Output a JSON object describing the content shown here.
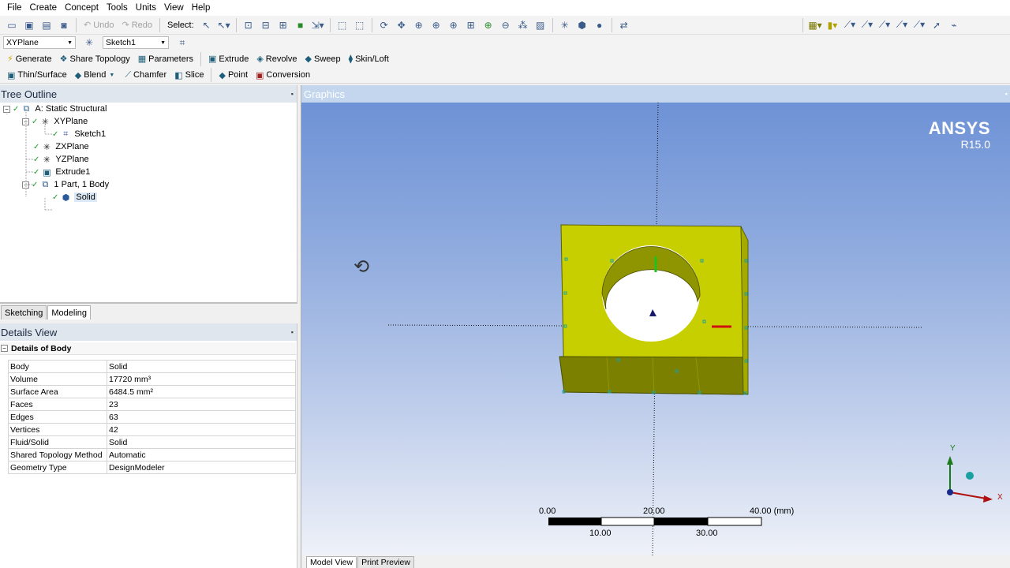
{
  "menubar": {
    "items": [
      "File",
      "Create",
      "Concept",
      "Tools",
      "Units",
      "View",
      "Help"
    ]
  },
  "toolbar1": {
    "undo_label": "Undo",
    "redo_label": "Redo",
    "select_label": "Select:"
  },
  "toolbar2": {
    "plane_combo": "XYPlane",
    "sketch_combo": "Sketch1"
  },
  "toolbar3": {
    "buttons": [
      "Generate",
      "Share Topology",
      "Parameters",
      "Extrude",
      "Revolve",
      "Sweep",
      "Skin/Loft"
    ]
  },
  "toolbar4": {
    "buttons": [
      "Thin/Surface",
      "Blend",
      "Chamfer",
      "Slice",
      "Point",
      "Conversion"
    ]
  },
  "tree": {
    "title": "Tree Outline",
    "nodes": [
      "A: Static Structural",
      "XYPlane",
      "Sketch1",
      "ZXPlane",
      "YZPlane",
      "Extrude1",
      "1 Part, 1 Body",
      "Solid"
    ]
  },
  "mode_tabs": {
    "sketching": "Sketching",
    "modeling": "Modeling"
  },
  "details": {
    "title": "Details View",
    "header": "Details of Body",
    "rows": [
      {
        "key": "Body",
        "value": "Solid"
      },
      {
        "key": "Volume",
        "value": "17720 mm³"
      },
      {
        "key": "Surface Area",
        "value": "6484.5 mm²"
      },
      {
        "key": "Faces",
        "value": "23"
      },
      {
        "key": "Edges",
        "value": "63"
      },
      {
        "key": "Vertices",
        "value": "42"
      },
      {
        "key": "Fluid/Solid",
        "value": "Solid"
      },
      {
        "key": "Shared Topology Method",
        "value": "Automatic"
      },
      {
        "key": "Geometry Type",
        "value": "DesignModeler"
      }
    ]
  },
  "graphics": {
    "title": "Graphics",
    "logo": "ANSYS",
    "version": "R15.0",
    "scale": {
      "top": [
        "0.00",
        "20.00",
        "40.00 (mm)"
      ],
      "bottom": [
        "10.00",
        "30.00"
      ]
    },
    "axes": {
      "y": "Y",
      "x": "X"
    },
    "view_tabs": [
      "Model View",
      "Print Preview"
    ]
  },
  "colors": {
    "body": "#c8cf00",
    "body_dark": "#7b8000",
    "viewport_top": "#6e92d6",
    "viewport_bottom": "#eef1f8"
  }
}
